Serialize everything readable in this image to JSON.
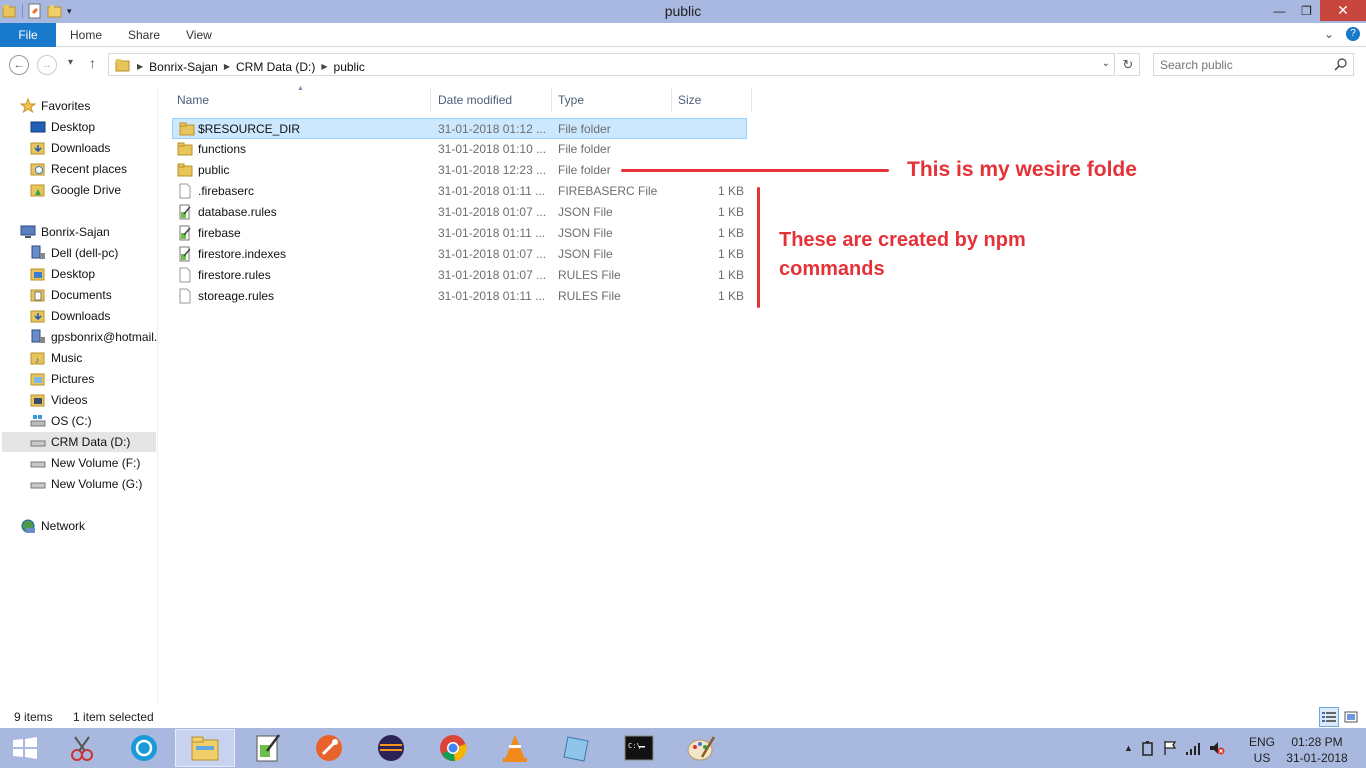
{
  "window": {
    "title": "public",
    "min_label": "—",
    "max_label": "❐",
    "close_label": "✕"
  },
  "ribbon": {
    "tabs": [
      "File",
      "Home",
      "Share",
      "View"
    ]
  },
  "address": {
    "crumbs": [
      "Bonrix-Sajan",
      "CRM Data (D:)",
      "public"
    ]
  },
  "search": {
    "placeholder": "Search public"
  },
  "nav": {
    "favorites_label": "Favorites",
    "favorites": [
      "Desktop",
      "Downloads",
      "Recent places",
      "Google Drive"
    ],
    "computer_label": "Bonrix-Sajan",
    "computer_items": [
      "Dell (dell-pc)",
      "Desktop",
      "Documents",
      "Downloads",
      "gpsbonrix@hotmail.",
      "Music",
      "Pictures",
      "Videos",
      "OS (C:)",
      "CRM Data (D:)",
      "New Volume (F:)",
      "New Volume (G:)"
    ],
    "network_label": "Network"
  },
  "columns": {
    "name": "Name",
    "date": "Date modified",
    "type": "Type",
    "size": "Size"
  },
  "files": [
    {
      "name": "$RESOURCE_DIR",
      "date": "31-01-2018 01:12 ...",
      "type": "File folder",
      "size": ""
    },
    {
      "name": "functions",
      "date": "31-01-2018 01:10 ...",
      "type": "File folder",
      "size": ""
    },
    {
      "name": "public",
      "date": "31-01-2018 12:23 ...",
      "type": "File folder",
      "size": ""
    },
    {
      "name": ".firebaserc",
      "date": "31-01-2018 01:11 ...",
      "type": "FIREBASERC File",
      "size": "1 KB"
    },
    {
      "name": "database.rules",
      "date": "31-01-2018 01:07 ...",
      "type": "JSON File",
      "size": "1 KB"
    },
    {
      "name": "firebase",
      "date": "31-01-2018 01:11 ...",
      "type": "JSON File",
      "size": "1 KB"
    },
    {
      "name": "firestore.indexes",
      "date": "31-01-2018 01:07 ...",
      "type": "JSON File",
      "size": "1 KB"
    },
    {
      "name": "firestore.rules",
      "date": "31-01-2018 01:07 ...",
      "type": "RULES File",
      "size": "1 KB"
    },
    {
      "name": "storeage.rules",
      "date": "31-01-2018 01:11 ...",
      "type": "RULES File",
      "size": "1 KB"
    }
  ],
  "annotations": {
    "folder_note": "This is my wesire folde",
    "npm_note": "These are created by npm commands",
    "color": "#e53238"
  },
  "status": {
    "count": "9 items",
    "selected": "1 item selected"
  },
  "taskbar": {
    "lang_top": "ENG",
    "lang_bottom": "US",
    "time": "01:28 PM",
    "date": "31-01-2018"
  },
  "colors": {
    "titlebar": "#a8b8e0",
    "file_tab": "#1979ca",
    "selection": "#cce8ff",
    "taskbar": "#a9b8df",
    "close": "#c7463d"
  }
}
